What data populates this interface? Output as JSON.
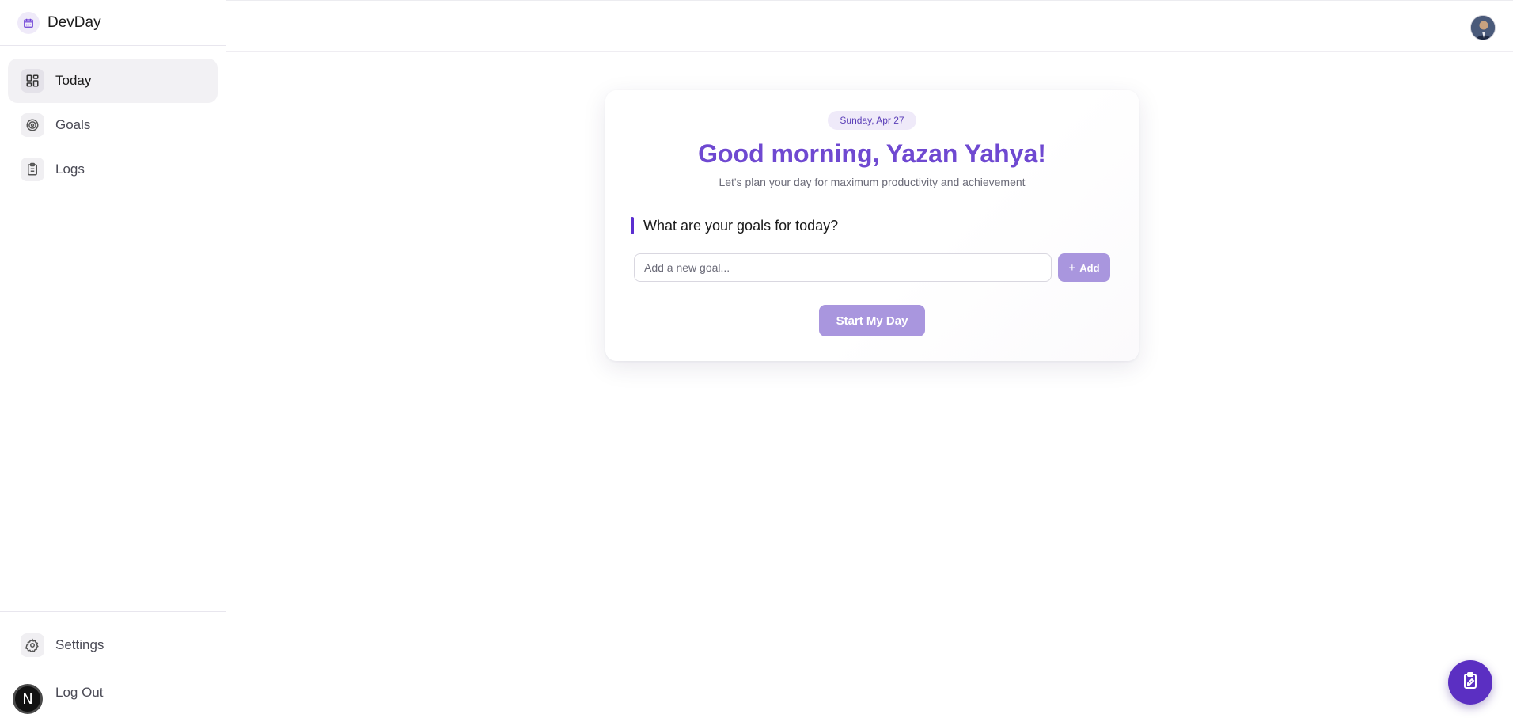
{
  "app": {
    "name": "DevDay",
    "accent_color": "#6d3fd6"
  },
  "sidebar": {
    "items": [
      {
        "label": "Today",
        "icon": "dashboard-icon",
        "active": true
      },
      {
        "label": "Goals",
        "icon": "target-icon",
        "active": false
      },
      {
        "label": "Logs",
        "icon": "clipboard-list-icon",
        "active": false
      }
    ],
    "bottom": [
      {
        "label": "Settings",
        "icon": "gear-icon"
      },
      {
        "label": "Log Out",
        "icon": "next-logo-icon"
      }
    ]
  },
  "main": {
    "date": "Sunday, Apr 27",
    "greeting": "Good morning, Yazan Yahya!",
    "subtitle": "Let's plan your day for maximum productivity and achievement",
    "goals_heading": "What are your goals for today?",
    "goal_input_placeholder": "Add a new goal...",
    "add_label": "Add",
    "start_label": "Start My Day"
  },
  "colors": {
    "primary": "#6f49d1",
    "button_disabled": "#a996de",
    "fab": "#5b2fc2"
  }
}
